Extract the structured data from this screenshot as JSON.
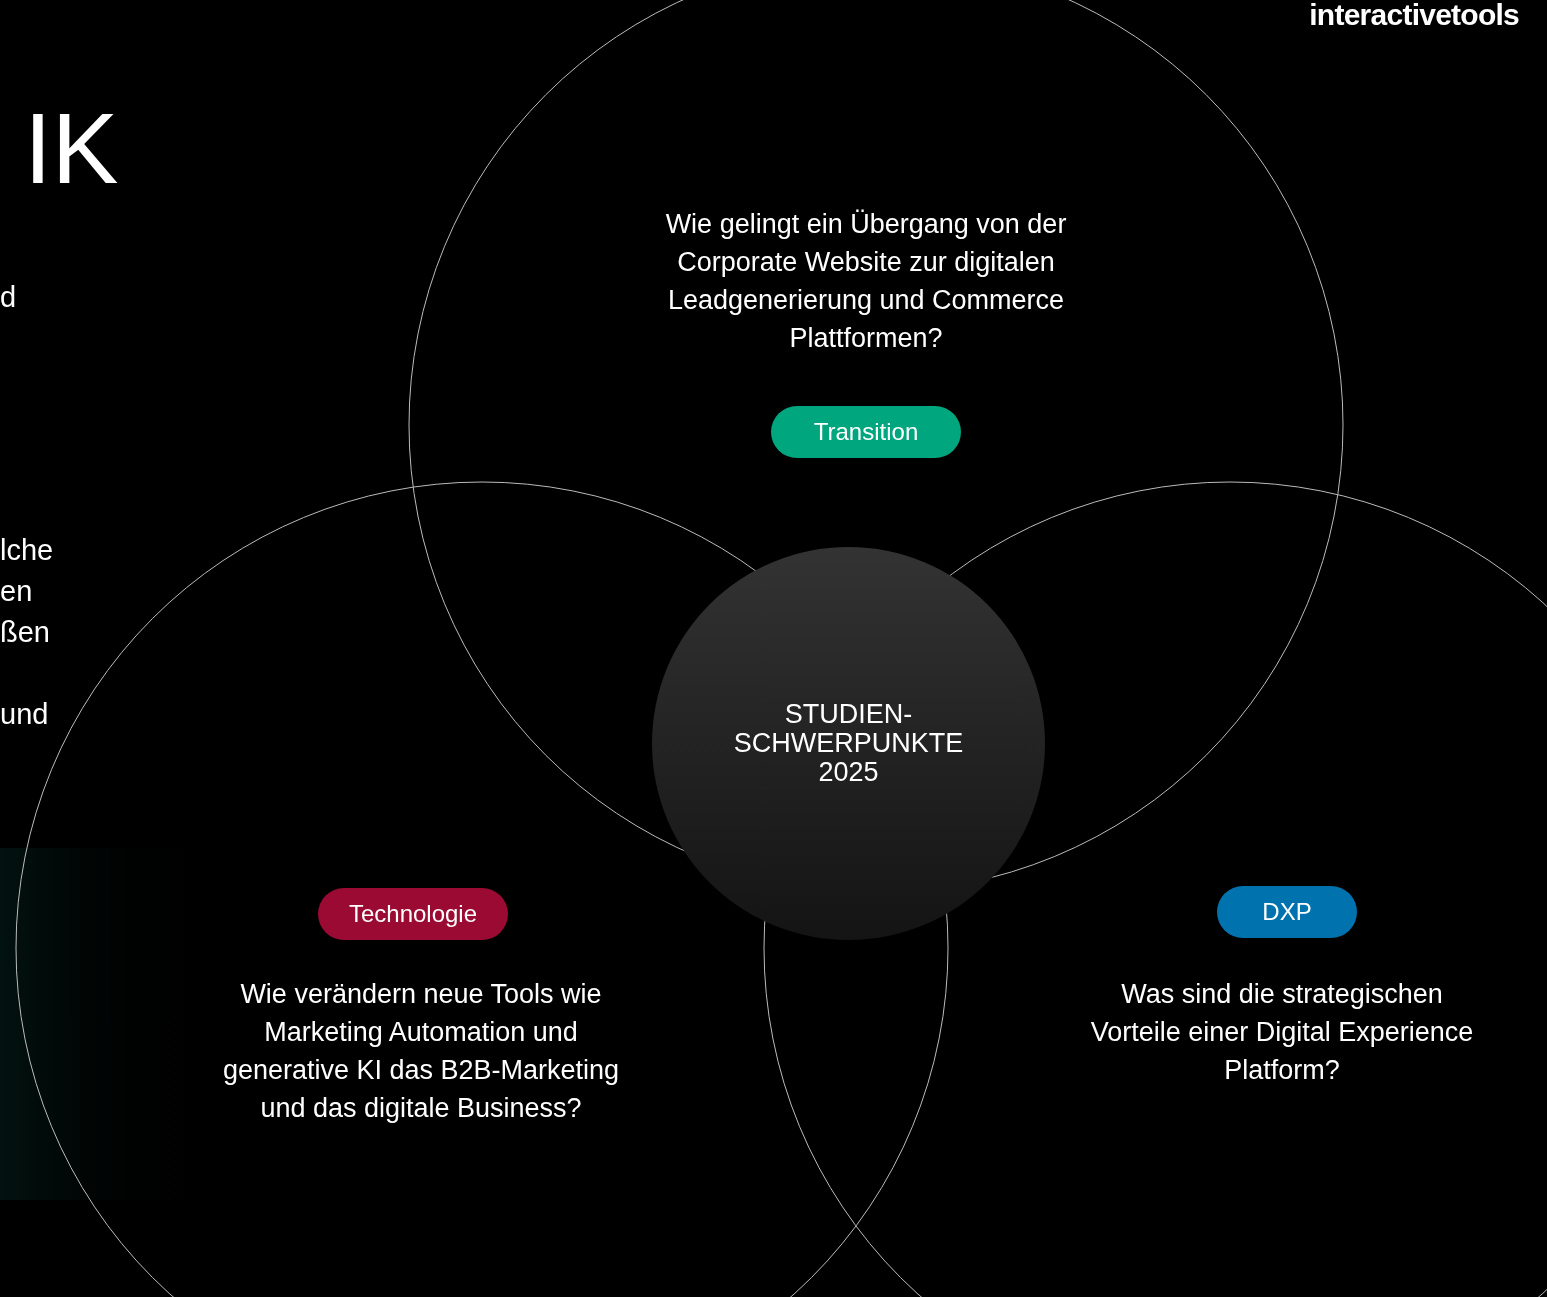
{
  "logo": "interactivetools",
  "heading_fragment": "IK",
  "left_text_fragments": [
    "d",
    "lche",
    "en",
    "ßen",
    "und"
  ],
  "center_label": "STUDIEN-\nSCHWERPUNKTE\n2025",
  "topics": [
    {
      "kind": "top",
      "label": "Transition",
      "color": "#00a67e",
      "question": "Wie gelingt ein Übergang von der\nCorporate Website zur digitalen\nLeadgenerierung und Commerce\nPlattformen?"
    },
    {
      "kind": "left",
      "label": "Technologie",
      "color": "#9a0a32",
      "question": "Wie verändern neue Tools wie\nMarketing Automation und\ngenerative KI das B2B-Marketing\nund das digitale Business?"
    },
    {
      "kind": "right",
      "label": "DXP",
      "color": "#0072ad",
      "question": "Was sind die strategischen\nVorteile einer Digital Experience\nPlatform?"
    }
  ]
}
